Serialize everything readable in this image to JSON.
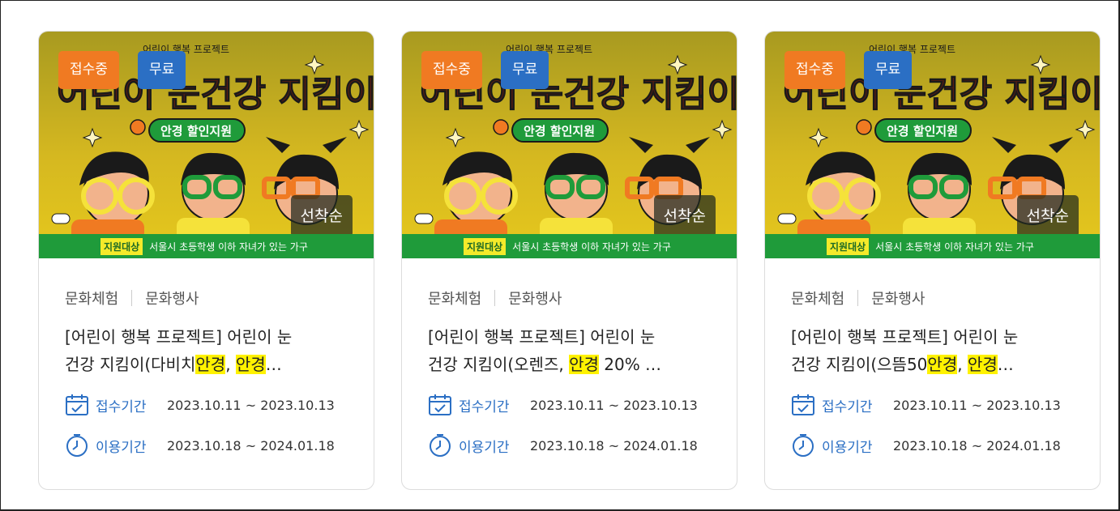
{
  "cards": [
    {
      "status": "접수중",
      "fee": "무료",
      "first_come": "선착순",
      "banner_small": "어린이 행복 프로젝트",
      "banner_title": "어린이 눈건강 지킴이",
      "banner_sub": "안경 할인지원",
      "target_tag": "지원대상",
      "target_text": "서울시 초등학생 이하 자녀가 있는 가구",
      "category1": "문화체험",
      "category2": "문화행사",
      "title_line1": "[어린이 행복 프로젝트] 어린이 눈",
      "title_line2_a": "건강 지킴이(다비치",
      "title_line2_hl1": "안경",
      "title_line2_b": ", ",
      "title_line2_hl2": "안경",
      "title_line2_c": "…",
      "apply_label": "접수기간",
      "apply_period": "2023.10.11 ~ 2023.10.13",
      "use_label": "이용기간",
      "use_period": "2023.10.18 ~ 2024.01.18"
    },
    {
      "status": "접수중",
      "fee": "무료",
      "first_come": "선착순",
      "banner_small": "어린이 행복 프로젝트",
      "banner_title": "어린이 눈건강 지킴이",
      "banner_sub": "안경 할인지원",
      "target_tag": "지원대상",
      "target_text": "서울시 초등학생 이하 자녀가 있는 가구",
      "category1": "문화체험",
      "category2": "문화행사",
      "title_line1": "[어린이 행복 프로젝트] 어린이 눈",
      "title_line2_a": "건강 지킴이(오렌즈, ",
      "title_line2_hl1": "안경",
      "title_line2_b": " 20% …",
      "title_line2_hl2": "",
      "title_line2_c": "",
      "apply_label": "접수기간",
      "apply_period": "2023.10.11 ~ 2023.10.13",
      "use_label": "이용기간",
      "use_period": "2023.10.18 ~ 2024.01.18"
    },
    {
      "status": "접수중",
      "fee": "무료",
      "first_come": "선착순",
      "banner_small": "어린이 행복 프로젝트",
      "banner_title": "어린이 눈건강 지킴이",
      "banner_sub": "안경 할인지원",
      "target_tag": "지원대상",
      "target_text": "서울시 초등학생 이하 자녀가 있는 가구",
      "category1": "문화체험",
      "category2": "문화행사",
      "title_line1": "[어린이 행복 프로젝트] 어린이 눈",
      "title_line2_a": "건강 지킴이(으뜸50",
      "title_line2_hl1": "안경",
      "title_line2_b": ", ",
      "title_line2_hl2": "안경",
      "title_line2_c": "…",
      "apply_label": "접수기간",
      "apply_period": "2023.10.11 ~ 2023.10.13",
      "use_label": "이용기간",
      "use_period": "2023.10.18 ~ 2024.01.18"
    }
  ],
  "colors": {
    "status_badge": "#f07a22",
    "fee_badge": "#2b6fc4",
    "highlight": "#fff200",
    "label_blue": "#2b6fc4",
    "stripe_green": "#1f9b3a"
  },
  "icons": {
    "apply": "calendar-check-icon",
    "use": "clock-icon"
  }
}
